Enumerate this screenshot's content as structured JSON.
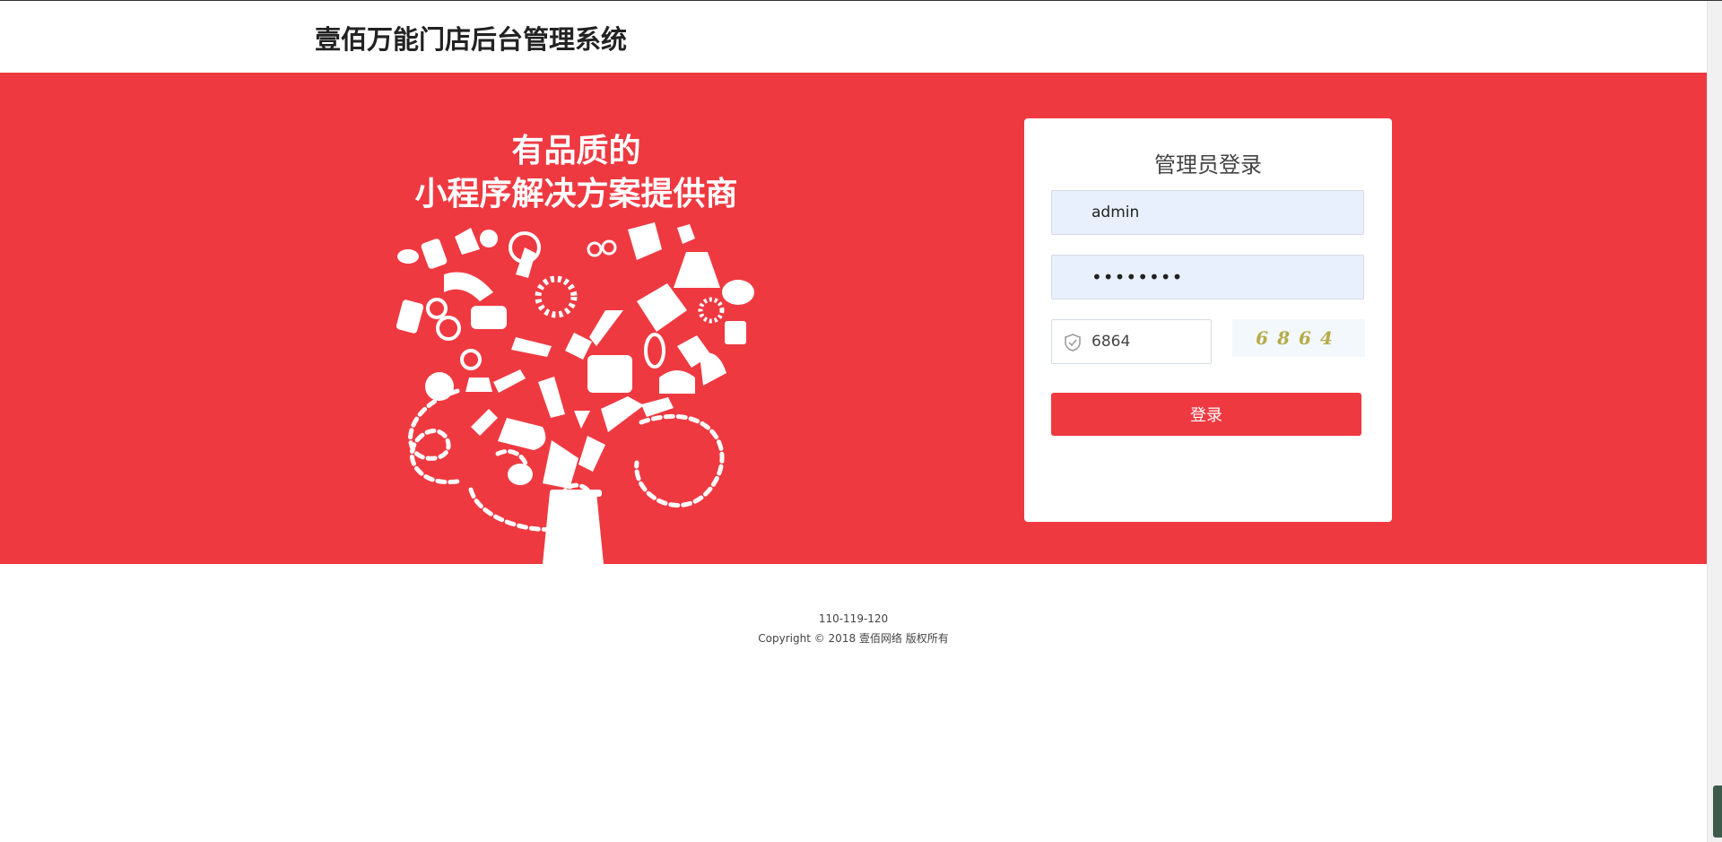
{
  "header": {
    "brand": "壹佰万能门店后台管理系统"
  },
  "banner": {
    "slogan_line1": "有品质的",
    "slogan_line2": "小程序解决方案提供商"
  },
  "login": {
    "title": "管理员登录",
    "username_value": "admin",
    "password_value": "••••••••",
    "captcha_value": "6864",
    "captcha_image_text": "6864",
    "submit_label": "登录"
  },
  "footer": {
    "phone": "110-119-120",
    "copyright": "Copyright © 2018 壹佰网络 版权所有"
  },
  "colors": {
    "brand_red": "#ef3941",
    "input_bg": "#e8f0fe"
  }
}
